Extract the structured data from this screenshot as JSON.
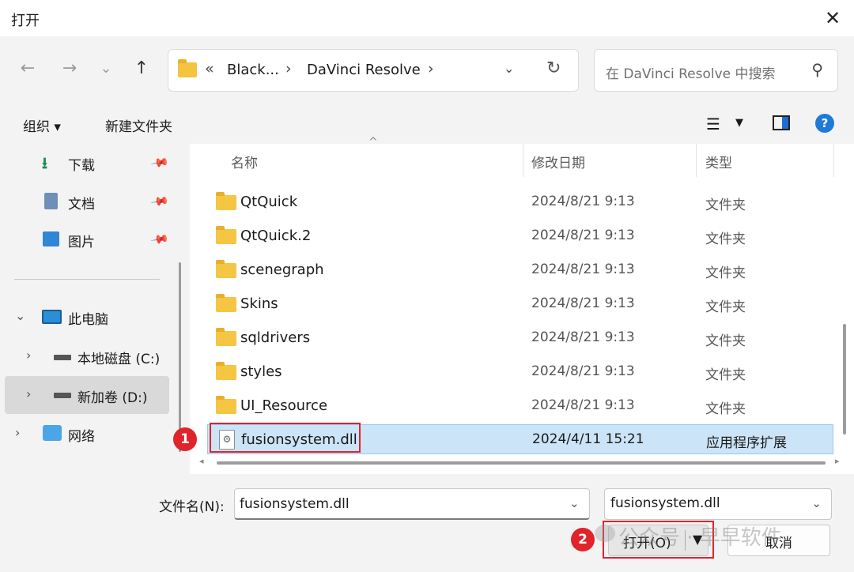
{
  "window": {
    "title": "打开",
    "close_glyph": "✕"
  },
  "nav": {
    "back_glyph": "←",
    "forward_glyph": "→",
    "recent_glyph": "⌄",
    "up_glyph": "↑",
    "breadcrumb_prefix": "«",
    "breadcrumbs": [
      "Black...",
      "DaVinci Resolve"
    ],
    "crumb_sep": "›",
    "dropdown_glyph": "⌄",
    "refresh_glyph": "↻",
    "search_placeholder": "在 DaVinci Resolve 中搜索",
    "search_glyph": "⚲"
  },
  "toolbar": {
    "organize_label": "组织 ▾",
    "new_folder_label": "新建文件夹",
    "view_glyph": "☰",
    "view_caret": "▼",
    "help_glyph": "?"
  },
  "sidebar": {
    "quick_access": [
      {
        "label": "下载",
        "icon": "download-icon"
      },
      {
        "label": "文档",
        "icon": "document-icon"
      },
      {
        "label": "图片",
        "icon": "pictures-icon"
      }
    ],
    "pin_glyph": "📌",
    "tree": [
      {
        "label": "此电脑",
        "icon": "computer-icon",
        "chevron": "⌄"
      },
      {
        "label": "本地磁盘 (C:)",
        "icon": "drive-icon",
        "chevron": "›"
      },
      {
        "label": "新加卷 (D:)",
        "icon": "drive-icon",
        "chevron": "›",
        "selected": true
      },
      {
        "label": "网络",
        "icon": "network-icon",
        "chevron": "›"
      }
    ]
  },
  "columns": {
    "name": "名称",
    "date": "修改日期",
    "type": "类型",
    "sort_glyph": "^"
  },
  "files": [
    {
      "name": "QtQuick",
      "date": "2024/8/21 9:13",
      "type": "文件夹",
      "kind": "folder"
    },
    {
      "name": "QtQuick.2",
      "date": "2024/8/21 9:13",
      "type": "文件夹",
      "kind": "folder"
    },
    {
      "name": "scenegraph",
      "date": "2024/8/21 9:13",
      "type": "文件夹",
      "kind": "folder"
    },
    {
      "name": "Skins",
      "date": "2024/8/21 9:13",
      "type": "文件夹",
      "kind": "folder"
    },
    {
      "name": "sqldrivers",
      "date": "2024/8/21 9:13",
      "type": "文件夹",
      "kind": "folder"
    },
    {
      "name": "styles",
      "date": "2024/8/21 9:13",
      "type": "文件夹",
      "kind": "folder"
    },
    {
      "name": "UI_Resource",
      "date": "2024/8/21 9:13",
      "type": "文件夹",
      "kind": "folder"
    },
    {
      "name": "fusionsystem.dll",
      "date": "2024/4/11 15:21",
      "type": "应用程序扩展",
      "kind": "dll",
      "selected": true
    }
  ],
  "scroll": {
    "left_glyph": "◂",
    "right_glyph": "▸"
  },
  "bottom": {
    "filename_label": "文件名(N):",
    "filename_value": "fusionsystem.dll",
    "filename_dropdown": "⌄",
    "filetype_value": "fusionsystem.dll",
    "filetype_dropdown": "⌄",
    "open_label": "打开(O)",
    "open_caret": "▼",
    "cancel_label": "取消"
  },
  "annotations": {
    "step1": "1",
    "step2": "2",
    "accent": "#e1232b"
  },
  "watermark": "公众号 · 早早软件"
}
